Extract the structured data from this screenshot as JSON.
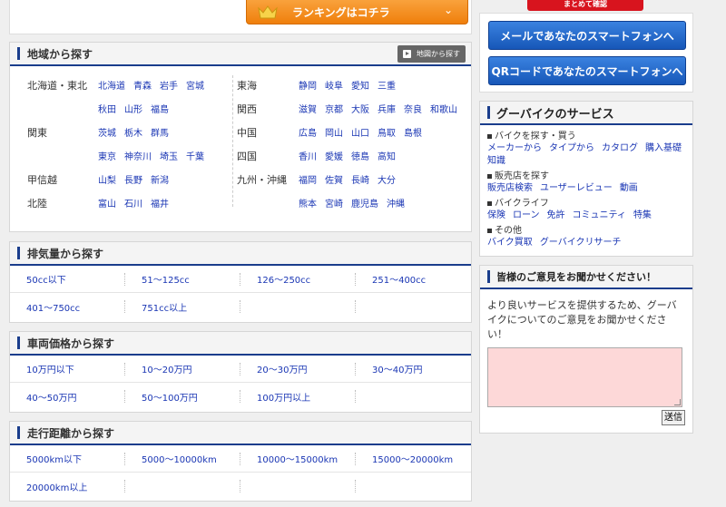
{
  "ranking_button": {
    "label": "ランキングはコチラ"
  },
  "top_strip": {
    "label": "まとめて確認"
  },
  "region": {
    "title": "地域から探す",
    "map_button": "地図から探す",
    "left": [
      {
        "name": "北海道・東北",
        "links": [
          "北海道",
          "青森",
          "岩手",
          "宮城"
        ]
      },
      {
        "name": "",
        "links": [
          "秋田",
          "山形",
          "福島"
        ]
      },
      {
        "name": "関東",
        "links": [
          "茨城",
          "栃木",
          "群馬"
        ]
      },
      {
        "name": "",
        "links": [
          "東京",
          "神奈川",
          "埼玉",
          "千葉"
        ]
      },
      {
        "name": "甲信越",
        "links": [
          "山梨",
          "長野",
          "新潟"
        ]
      },
      {
        "name": "北陸",
        "links": [
          "富山",
          "石川",
          "福井"
        ]
      }
    ],
    "right": [
      {
        "name": "東海",
        "links": [
          "静岡",
          "岐阜",
          "愛知",
          "三重"
        ]
      },
      {
        "name": "関西",
        "links": [
          "滋賀",
          "京都",
          "大阪",
          "兵庫",
          "奈良",
          "和歌山"
        ]
      },
      {
        "name": "中国",
        "links": [
          "広島",
          "岡山",
          "山口",
          "鳥取",
          "島根"
        ]
      },
      {
        "name": "四国",
        "links": [
          "香川",
          "愛媛",
          "徳島",
          "高知"
        ]
      },
      {
        "name": "九州・沖縄",
        "links": [
          "福岡",
          "佐賀",
          "長崎",
          "大分"
        ]
      },
      {
        "name": "",
        "links": [
          "熊本",
          "宮崎",
          "鹿児島",
          "沖縄"
        ]
      }
    ]
  },
  "displacement": {
    "title": "排気量から探す",
    "items": [
      "50cc以下",
      "51～125cc",
      "126～250cc",
      "251～400cc",
      "401～750cc",
      "751cc以上"
    ]
  },
  "price": {
    "title": "車両価格から探す",
    "items": [
      "10万円以下",
      "10～20万円",
      "20～30万円",
      "30～40万円",
      "40～50万円",
      "50～100万円",
      "100万円以上"
    ]
  },
  "mileage": {
    "title": "走行距離から探す",
    "items": [
      "5000km以下",
      "5000～10000km",
      "10000～15000km",
      "15000～20000km",
      "20000km以上"
    ]
  },
  "smartphone": {
    "mail_button": "メールであなたのスマートフォンへ",
    "qr_button": "QRコードであなたのスマートフォンへ"
  },
  "services": {
    "title": "グーバイクのサービス",
    "groups": [
      {
        "category": "バイクを探す・買う",
        "links": [
          "メーカーから",
          "タイプから",
          "カタログ",
          "購入基礎知識"
        ]
      },
      {
        "category": "販売店を探す",
        "links": [
          "販売店検索",
          "ユーザーレビュー",
          "動画"
        ]
      },
      {
        "category": "バイクライフ",
        "links": [
          "保険",
          "ローン",
          "免許",
          "コミュニティ",
          "特集"
        ]
      },
      {
        "category": "その他",
        "links": [
          "バイク買取",
          "グーバイクリサーチ"
        ]
      }
    ]
  },
  "opinion": {
    "title": "皆様のご意見をお聞かせください！",
    "text": "より良いサービスを提供するため、グーバイクについてのご意見をお聞かせください！",
    "send_button": "送信"
  },
  "colors": {
    "accent_blue": "#1a3d8c",
    "link": "#1a36b4",
    "orange": "#ef7f0c",
    "red": "#d8141e"
  }
}
